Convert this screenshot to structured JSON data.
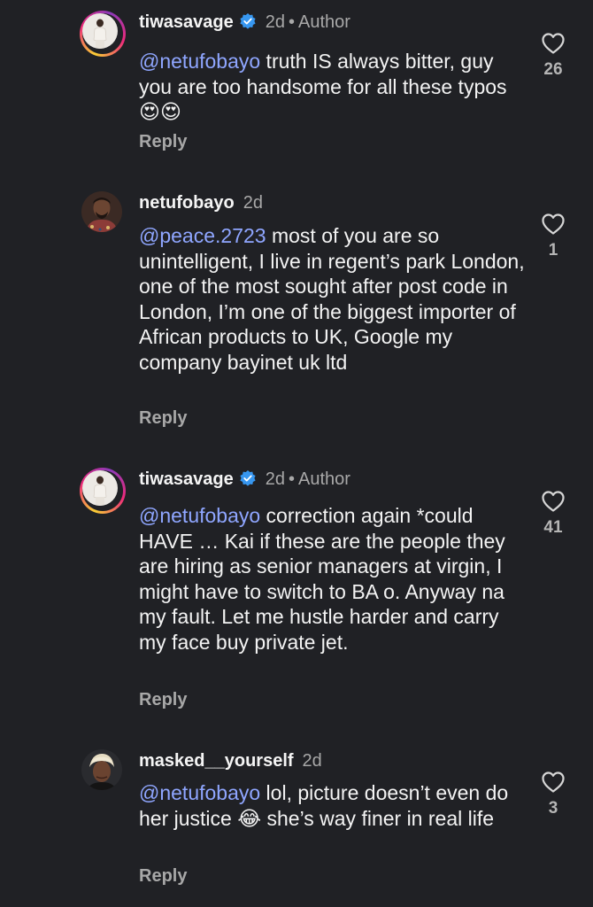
{
  "comments": [
    {
      "username": "tiwasavage",
      "time": "2d",
      "author_label": "Author",
      "mention": "@netufobayo",
      "text": " truth IS always bitter, guy you are too handsome for all these typos 😍😍",
      "reply_label": "Reply",
      "likes": "26"
    },
    {
      "username": "netufobayo",
      "time": "2d",
      "mention": "@peace.2723",
      "text": " most of you are so unintelligent, I live in regent’s park London, one of the most sought after post code in London, I’m one of the biggest importer of African products to UK, Google my company bayinet uk ltd",
      "reply_label": "Reply",
      "likes": "1"
    },
    {
      "username": "tiwasavage",
      "time": "2d",
      "author_label": "Author",
      "mention": "@netufobayo",
      "text": " correction again *could HAVE … Kai if these are the people they are hiring as senior managers at virgin, I might have to switch to BA o. Anyway na my fault. Let me hustle harder and carry my face buy private jet.",
      "reply_label": "Reply",
      "likes": "41"
    },
    {
      "username": "masked__yourself",
      "time": "2d",
      "mention": "@netufobayo",
      "text": " lol, picture doesn’t even do her justice 😂 she’s way finer in real life",
      "reply_label": "Reply",
      "likes": "3"
    }
  ],
  "colors": {
    "background": "#202125",
    "mention": "#8fa6ff",
    "verified_badge": "#3797f0",
    "secondary_text": "#a8a8a8"
  },
  "icons": [
    "verified-badge-icon",
    "heart-outline-icon"
  ]
}
